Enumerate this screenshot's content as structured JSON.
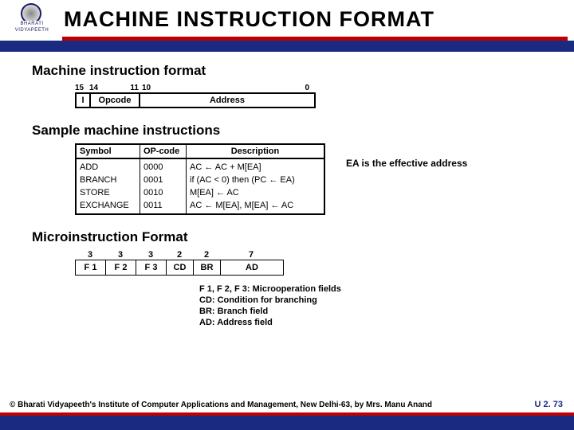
{
  "header": {
    "logo_top": "BHARATI",
    "logo_bot": "VIDYAPEETH",
    "title": "MACHINE  INSTRUCTION  FORMAT"
  },
  "section1": {
    "heading": "Machine instruction format",
    "bits": {
      "b15": "15",
      "b14": "14",
      "b11": "11",
      "b10": "10",
      "b0": "0"
    },
    "fields": {
      "i": "I",
      "opcode": "Opcode",
      "address": "Address"
    }
  },
  "section2": {
    "heading": "Sample machine instructions",
    "columns": {
      "sym": "Symbol",
      "op": "OP-code",
      "desc": "Description"
    },
    "rows": [
      {
        "sym": "ADD",
        "op": "0000",
        "desc": "AC ← AC + M[EA]"
      },
      {
        "sym": "BRANCH",
        "op": "0001",
        "desc": "if (AC < 0) then (PC ← EA)"
      },
      {
        "sym": "STORE",
        "op": "0010",
        "desc": "M[EA] ← AC"
      },
      {
        "sym": "EXCHANGE",
        "op": "0011",
        "desc": "AC ← M[EA], M[EA] ← AC"
      }
    ],
    "note": "EA is the effective address"
  },
  "section3": {
    "heading": "Microinstruction Format",
    "bits": {
      "f1": "3",
      "f2": "3",
      "f3": "3",
      "cd": "2",
      "br": "2",
      "ad": "7"
    },
    "fields": {
      "f1": "F 1",
      "f2": "F 2",
      "f3": "F 3",
      "cd": "CD",
      "br": "BR",
      "ad": "AD"
    },
    "legend": {
      "l1": "F 1, F 2, F 3: Microoperation fields",
      "l2": "CD: Condition for branching",
      "l3": "BR: Branch field",
      "l4": "AD: Address field"
    }
  },
  "footer": {
    "copyright": "© Bharati Vidyapeeth's Institute of Computer Applications and Management, New Delhi-63, by Mrs. Manu Anand",
    "pageno": "U 2. 73"
  }
}
